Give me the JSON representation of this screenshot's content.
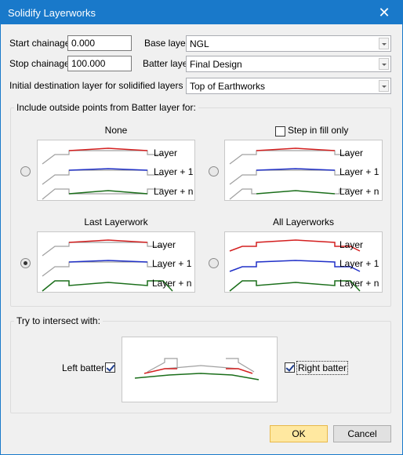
{
  "window": {
    "title": "Solidify Layerworks",
    "close_glyph": "✕"
  },
  "fields": {
    "start_chainage_label": "Start chainage",
    "start_chainage_value": "0.000",
    "stop_chainage_label": "Stop chainage",
    "stop_chainage_value": "100.000",
    "base_layer_label": "Base layer",
    "base_layer_value": "NGL",
    "batter_layer_label": "Batter layer",
    "batter_layer_value": "Final Design",
    "initial_dest_label": "Initial destination layer for solidified layers (L)",
    "initial_dest_value": "Top of Earthworks"
  },
  "include_group": {
    "legend": "Include outside points from Batter layer for:",
    "options": [
      {
        "caption": "None",
        "selected": false
      },
      {
        "caption": "Step in fill only",
        "checked": false
      },
      {
        "caption": "Last Layerwork",
        "selected": true
      },
      {
        "caption": "All Layerworks",
        "selected": false
      }
    ],
    "layer_labels": [
      "Layer",
      "Layer + 1",
      "Layer + n"
    ]
  },
  "intersect_group": {
    "legend": "Try to intersect with:",
    "left_batter_label": "Left batter",
    "left_batter_checked": true,
    "right_batter_label": "Right batter",
    "right_batter_checked": true
  },
  "buttons": {
    "ok": "OK",
    "cancel": "Cancel"
  },
  "colors": {
    "titlebar": "#1979ca",
    "layer_red": "#d42020",
    "layer_blue": "#2030c8",
    "layer_green": "#1a6e1a",
    "batter_grey": "#a0a0a0"
  }
}
